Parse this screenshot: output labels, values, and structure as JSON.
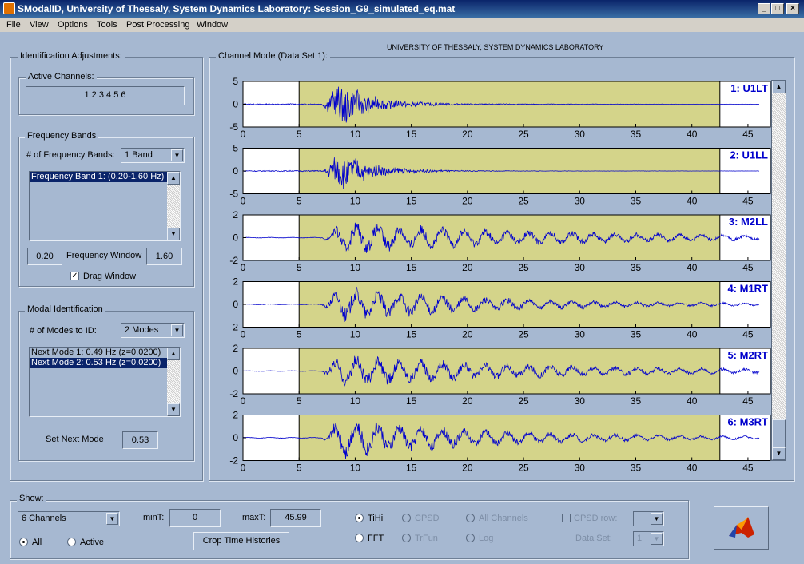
{
  "window": {
    "title": "SModalID, University of Thessaly, System Dynamics Laboratory: Session_G9_simulated_eq.mat"
  },
  "menu": [
    "File",
    "View",
    "Options",
    "Tools",
    "Post Processing",
    "Window"
  ],
  "plot_header": "UNIVERSITY OF THESSALY, SYSTEM DYNAMICS LABORATORY",
  "identification": {
    "title": "Identification Adjustments:",
    "active_channels_title": "Active Channels:",
    "active_channels_value": "1 2 3 4 5 6",
    "freq_bands_title": "Frequency Bands",
    "num_bands_label": "# of Frequency Bands:",
    "num_bands_value": "1 Band",
    "bands_list": [
      "Frequency Band 1: (0.20-1.60 Hz)"
    ],
    "window_low": "0.20",
    "window_label": "Frequency Window",
    "window_high": "1.60",
    "drag_window_label": "Drag Window",
    "modal_title": "Modal Identification",
    "num_modes_label": "# of Modes to ID:",
    "num_modes_value": "2 Modes",
    "modes_list": [
      "Next Mode 1: 0.49 Hz (z=0.0200)",
      "Next Mode 2: 0.53 Hz (z=0.0200)"
    ],
    "set_next_mode_label": "Set Next Mode",
    "set_next_mode_value": "0.53"
  },
  "channel_panel_title": "Channel Mode (Data Set 1):",
  "show": {
    "title": "Show:",
    "channels_value": "6 Channels",
    "all_label": "All",
    "active_label": "Active",
    "mint_label": "minT:",
    "mint_value": "0",
    "maxt_label": "maxT:",
    "maxt_value": "45.99",
    "crop_label": "Crop Time Histories",
    "tihi_label": "TiHi",
    "fft_label": "FFT",
    "cpsd_label": "CPSD",
    "trfun_label": "TrFun",
    "all_channels_label": "All Channels",
    "log_label": "Log",
    "cpsd_row_label": "CPSD row:",
    "data_set_label": "Data Set:",
    "data_set_value": "1"
  },
  "chart_data": {
    "type": "line",
    "title": "",
    "xlim": [
      0,
      47
    ],
    "xticks": [
      0,
      5,
      10,
      15,
      20,
      25,
      30,
      35,
      40,
      45
    ],
    "highlight_window": [
      5,
      42.5
    ],
    "colors": {
      "line": "#0000cc",
      "highlight": "#d4d48a",
      "label": "#0000cc"
    },
    "channels": [
      {
        "name": "1: U1LT",
        "yticks": [
          5,
          0,
          -5
        ],
        "ylim": [
          -5,
          5
        ],
        "peak": 4.2,
        "decay": 0.35,
        "tail": 0.1
      },
      {
        "name": "2: U1LL",
        "yticks": [
          5,
          0,
          -5
        ],
        "ylim": [
          -5,
          5
        ],
        "peak": 3.8,
        "decay": 0.35,
        "tail": 0.05
      },
      {
        "name": "3: M2LL",
        "yticks": [
          2,
          0,
          -2
        ],
        "ylim": [
          -2,
          2
        ],
        "peak": 1.2,
        "decay": 0.06,
        "tail": 0.35
      },
      {
        "name": "4: M1RT",
        "yticks": [
          2,
          0,
          -2
        ],
        "ylim": [
          -2,
          2
        ],
        "peak": 1.5,
        "decay": 0.08,
        "tail": 0.2
      },
      {
        "name": "5: M2RT",
        "yticks": [
          2,
          0,
          -2
        ],
        "ylim": [
          -2,
          2
        ],
        "peak": 1.3,
        "decay": 0.06,
        "tail": 0.25
      },
      {
        "name": "6: M3RT",
        "yticks": [
          2,
          0,
          -2
        ],
        "ylim": [
          -2,
          2
        ],
        "peak": 1.7,
        "decay": 0.08,
        "tail": 0.2
      }
    ]
  }
}
